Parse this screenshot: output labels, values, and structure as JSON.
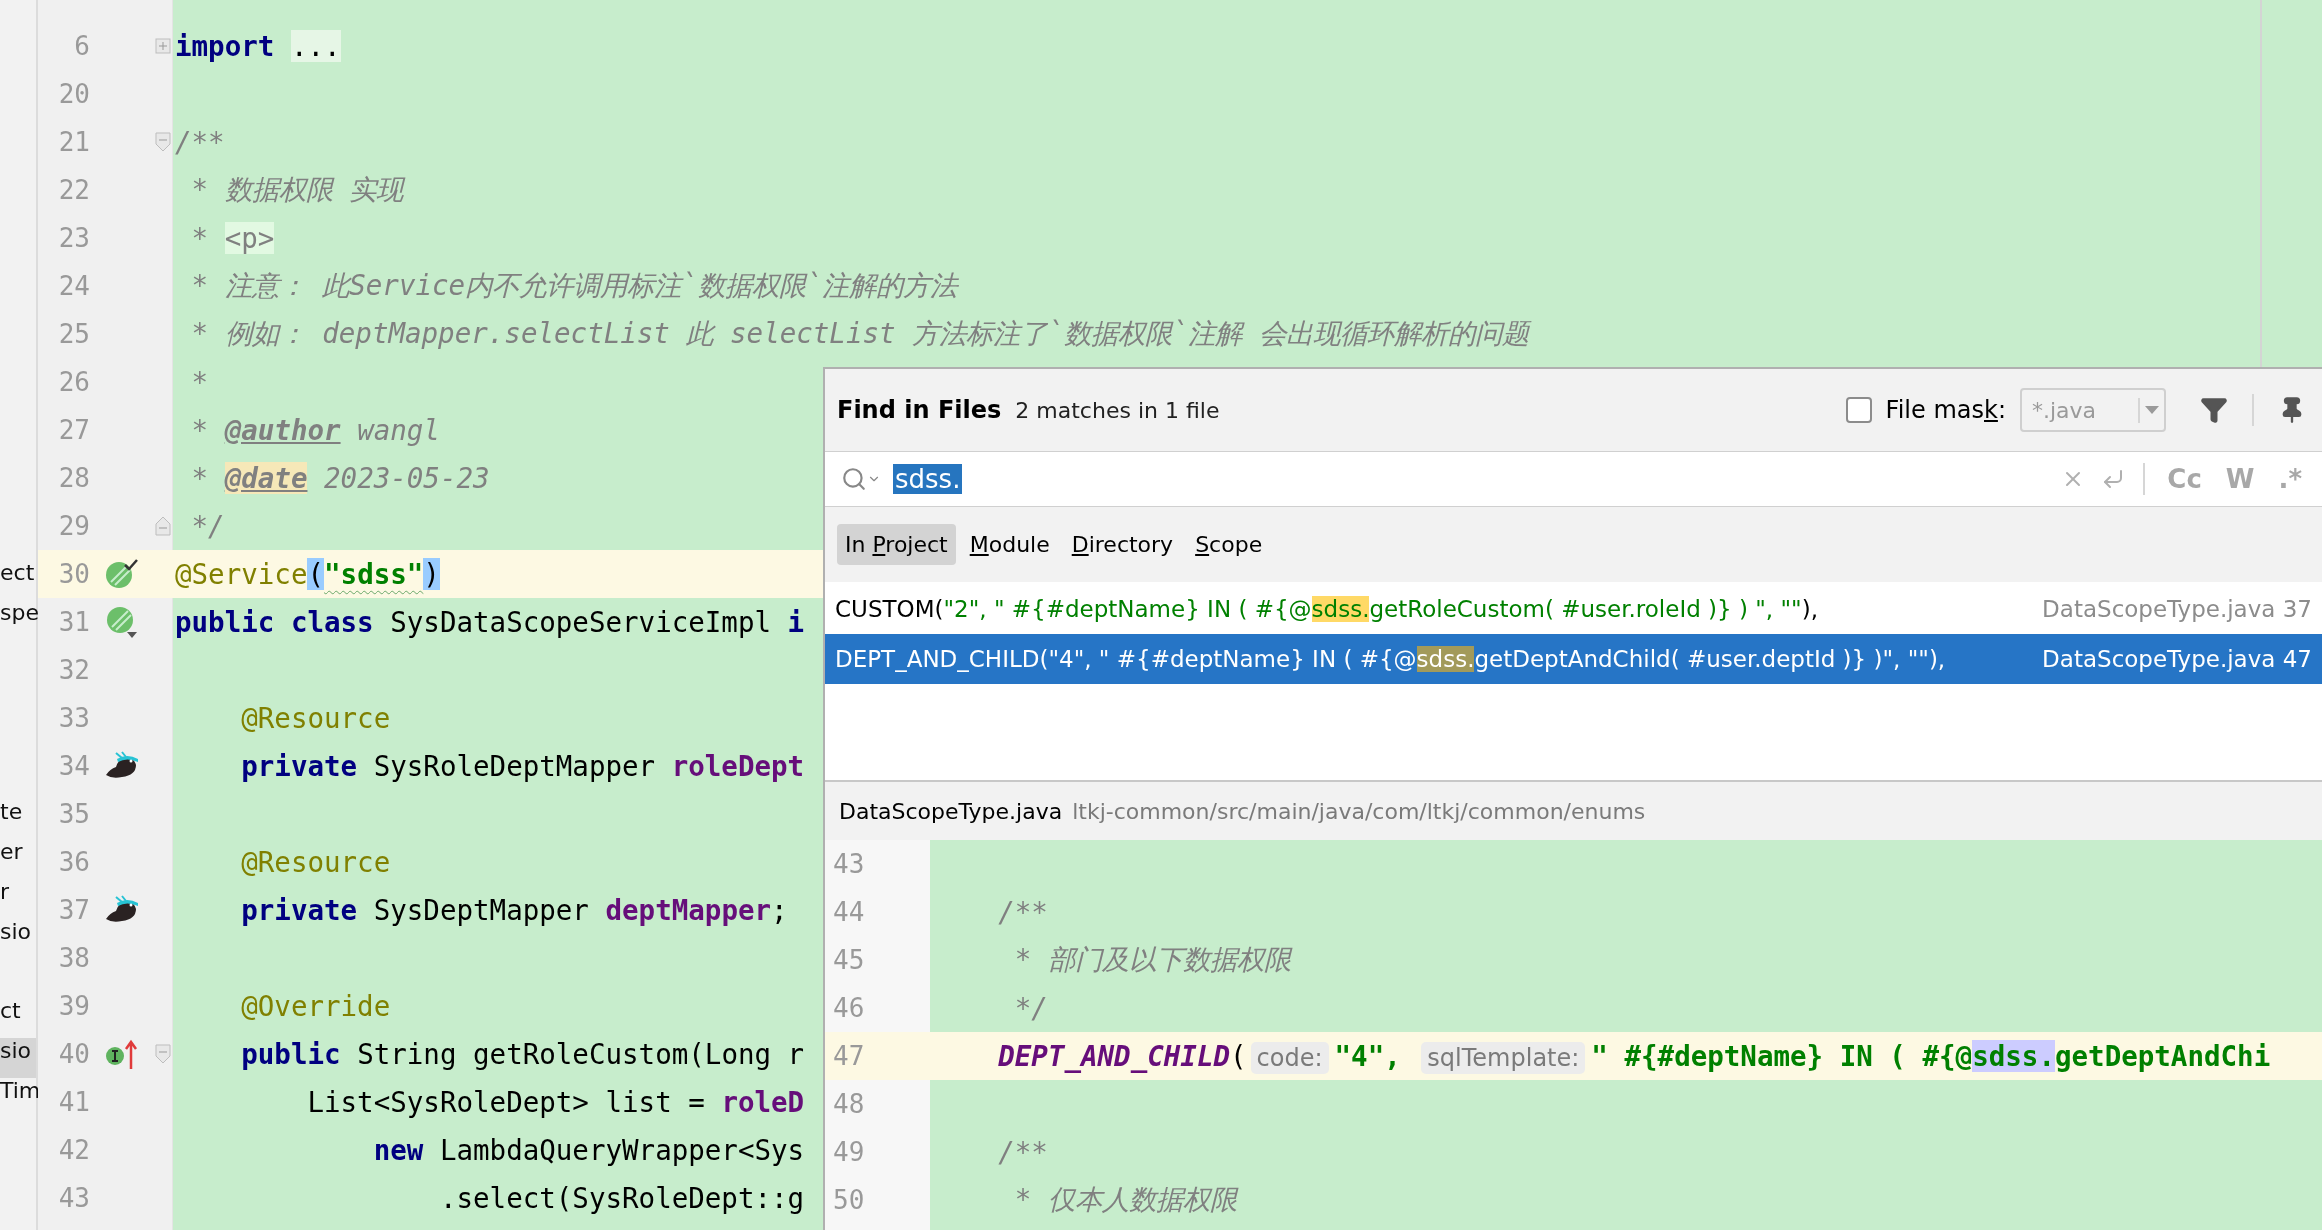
{
  "project_panel_fragments": [
    [
      {
        "text": "ect",
        "selected": false
      },
      {
        "text": "spe",
        "selected": false
      }
    ],
    [
      {
        "text": "te",
        "selected": false
      },
      {
        "text": "er",
        "selected": false
      },
      {
        "text": "r",
        "selected": false
      },
      {
        "text": "sio",
        "selected": false
      }
    ],
    [
      {
        "text": "ct",
        "selected": false
      },
      {
        "text": "sio",
        "selected": true
      },
      {
        "text": "Tim",
        "selected": false
      }
    ]
  ],
  "editor": {
    "lines": [
      {
        "number": "6",
        "fold_start": true,
        "collapsed": true,
        "current": false,
        "tokens": [
          {
            "kind": "kw",
            "text": "import "
          },
          {
            "kind": "folded",
            "text": "..."
          }
        ]
      },
      {
        "number": "20",
        "current": false
      },
      {
        "number": "21",
        "fold_start": true,
        "collapsed": false,
        "current": false,
        "tokens": [
          {
            "kind": "comment",
            "text": "/**"
          }
        ]
      },
      {
        "number": "22",
        "current": false,
        "tokens": [
          {
            "kind": "comment",
            "text": " * 数据权限 实现"
          }
        ]
      },
      {
        "number": "23",
        "current": false,
        "tokens": [
          {
            "kind": "comment",
            "text": " * "
          },
          {
            "kind": "html",
            "text": "<p>"
          }
        ]
      },
      {
        "number": "24",
        "current": false,
        "tokens": [
          {
            "kind": "comment",
            "text": " * 注意： 此Service内不允许调用标注`数据权限`注解的方法"
          }
        ]
      },
      {
        "number": "25",
        "current": false,
        "tokens": [
          {
            "kind": "comment",
            "text": " * 例如： deptMapper.selectList 此 selectList 方法标注了`数据权限`注解 会出现循环解析的问题"
          }
        ]
      },
      {
        "number": "26",
        "current": false,
        "tokens": [
          {
            "kind": "comment",
            "text": " *"
          }
        ]
      },
      {
        "number": "27",
        "current": false,
        "tokens": [
          {
            "kind": "comment",
            "text": " * "
          },
          {
            "kind": "doctag",
            "text": "@author"
          },
          {
            "kind": "comment",
            "text": " wangl"
          }
        ]
      },
      {
        "number": "28",
        "current": false,
        "tokens": [
          {
            "kind": "comment",
            "text": " * "
          },
          {
            "kind": "doctag-hl",
            "text": "@date"
          },
          {
            "kind": "comment",
            "text": " 2023-05-23"
          }
        ]
      },
      {
        "number": "29",
        "fold_end": true,
        "current": false,
        "tokens": [
          {
            "kind": "comment",
            "text": " */"
          }
        ]
      },
      {
        "number": "30",
        "kind": "bean-annotation",
        "current": true,
        "tokens": [
          {
            "kind": "ann",
            "text": "@Service"
          },
          {
            "kind": "brace",
            "text": "("
          },
          {
            "kind": "str-typo",
            "text": "\"sdss\""
          },
          {
            "kind": "brace",
            "text": ")"
          }
        ]
      },
      {
        "number": "31",
        "kind": "bean-class",
        "current": false,
        "tokens": [
          {
            "kind": "kw",
            "text": "public class"
          },
          {
            "kind": "plain",
            "text": " SysDataScopeServiceImpl "
          },
          {
            "kind": "kw",
            "text": "i"
          }
        ]
      },
      {
        "number": "32",
        "current": false
      },
      {
        "number": "33",
        "current": false,
        "tokens": [
          {
            "kind": "ann",
            "text": "    @Resource"
          }
        ]
      },
      {
        "number": "34",
        "kind": "injected-field",
        "current": false,
        "tokens": [
          {
            "kind": "kw",
            "text": "    private"
          },
          {
            "kind": "plain",
            "text": " SysRoleDeptMapper "
          },
          {
            "kind": "field",
            "text": "roleDept"
          }
        ]
      },
      {
        "number": "35",
        "current": false
      },
      {
        "number": "36",
        "current": false,
        "tokens": [
          {
            "kind": "ann",
            "text": "    @Resource"
          }
        ]
      },
      {
        "number": "37",
        "kind": "injected-field",
        "current": false,
        "tokens": [
          {
            "kind": "kw",
            "text": "    private"
          },
          {
            "kind": "plain",
            "text": " SysDeptMapper "
          },
          {
            "kind": "field",
            "text": "deptMapper"
          },
          {
            "kind": "plain",
            "text": ";"
          }
        ]
      },
      {
        "number": "38",
        "current": false
      },
      {
        "number": "39",
        "current": false,
        "tokens": [
          {
            "kind": "ann",
            "text": "    @Override"
          }
        ]
      },
      {
        "number": "40",
        "kind": "overriding-method",
        "fold_start": true,
        "collapsed": false,
        "current": false,
        "tokens": [
          {
            "kind": "kw",
            "text": "    public"
          },
          {
            "kind": "plain",
            "text": " String getRoleCustom(Long r"
          }
        ]
      },
      {
        "number": "41",
        "current": false,
        "tokens": [
          {
            "kind": "plain",
            "text": "        List<SysRoleDept> list = "
          },
          {
            "kind": "field",
            "text": "roleD"
          }
        ]
      },
      {
        "number": "42",
        "current": false,
        "tokens": [
          {
            "kind": "kw",
            "text": "            new"
          },
          {
            "kind": "plain",
            "text": " LambdaQueryWrapper<Sys"
          }
        ]
      },
      {
        "number": "43",
        "current": false,
        "tokens": [
          {
            "kind": "plain",
            "text": "                .select(SysRoleDept::g"
          }
        ]
      }
    ]
  },
  "find": {
    "title": "Find in Files",
    "summary": "2 matches in 1 file",
    "file_mask": {
      "checked": false,
      "label": {
        "before": "File mas",
        "mnemonic": "k",
        "after": ":"
      },
      "value": "*.java"
    },
    "search": {
      "value": "sdss.",
      "toggles": [
        "Cc",
        "W",
        ".*"
      ]
    },
    "scopes": [
      {
        "label": {
          "before": "In ",
          "mnemonic": "P",
          "after": "roject"
        },
        "selected": true
      },
      {
        "label": {
          "mnemonic": "M",
          "after": "odule"
        },
        "selected": false
      },
      {
        "label": {
          "mnemonic": "D",
          "after": "irectory"
        },
        "selected": false
      },
      {
        "label": {
          "mnemonic": "S",
          "after": "cope"
        },
        "selected": false
      }
    ],
    "results": [
      {
        "prefix": "CUSTOM(",
        "before": "\"2\", \" #{#deptName} IN ( #{@",
        "match": "sdss.",
        "after": "getRoleCustom( #user.roleId )} ) \", \"\"",
        "suffix": "),",
        "location": "DataScopeType.java 37",
        "selected": false
      },
      {
        "prefix": "DEPT_AND_CHILD(",
        "before": "\"4\", \" #{#deptName} IN ( #{@",
        "match": "sdss.",
        "after": "getDeptAndChild( #user.deptId )} )\", \"\"",
        "suffix": "),",
        "location": "DataScopeType.java 47",
        "selected": true
      }
    ],
    "preview": {
      "file": "DataScopeType.java",
      "path": "ltkj-common/src/main/java/com/ltkj/common/enums",
      "lines": [
        {
          "number": "43",
          "current": false
        },
        {
          "number": "44",
          "current": false,
          "tokens": [
            {
              "kind": "comment",
              "text": "    /**"
            }
          ]
        },
        {
          "number": "45",
          "current": false,
          "tokens": [
            {
              "kind": "comment",
              "text": "     * 部门及以下数据权限"
            }
          ]
        },
        {
          "number": "46",
          "current": false,
          "tokens": [
            {
              "kind": "comment",
              "text": "     */"
            }
          ]
        },
        {
          "number": "47",
          "current": true,
          "tokens": [
            {
              "kind": "enum",
              "text": "    DEPT_AND_CHILD"
            },
            {
              "kind": "plain",
              "text": "("
            },
            {
              "kind": "hint",
              "text": "code:"
            },
            {
              "kind": "str",
              "text": "\"4\", "
            },
            {
              "kind": "hint",
              "text": "sqlTemplate:"
            },
            {
              "kind": "str",
              "text": "\" #{#deptName} IN ( #{@"
            },
            {
              "kind": "match",
              "text": "sdss."
            },
            {
              "kind": "str",
              "text": "getDeptAndChi"
            }
          ]
        },
        {
          "number": "48",
          "current": false
        },
        {
          "number": "49",
          "current": false,
          "tokens": [
            {
              "kind": "comment",
              "text": "    /**"
            }
          ]
        },
        {
          "number": "50",
          "current": false,
          "tokens": [
            {
              "kind": "comment",
              "text": "     * 仅本人数据权限"
            }
          ]
        }
      ]
    }
  }
}
